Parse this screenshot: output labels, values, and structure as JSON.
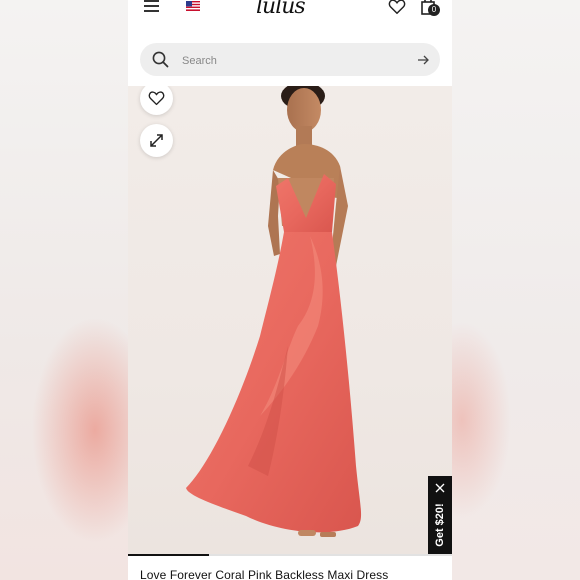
{
  "header": {
    "logo_text": "lulus",
    "menu_icon": "hamburger-menu-icon",
    "flag_icon": "us-flag-icon",
    "wishlist_icon": "heart-icon",
    "bag_icon": "shopping-bag-icon",
    "bag_count": "0"
  },
  "search": {
    "placeholder": "Search",
    "value": ""
  },
  "product": {
    "title": "Love Forever Coral Pink Backless Maxi Dress",
    "dress_color": "#e8685e",
    "image_progress": 0.25
  },
  "gallery": {
    "favorite_icon": "heart-outline-icon",
    "expand_icon": "expand-arrows-icon"
  },
  "promo": {
    "label": "Get $20!",
    "close_icon": "close-icon"
  },
  "colors": {
    "accent": "#111111",
    "search_bg": "#eeeeee"
  }
}
